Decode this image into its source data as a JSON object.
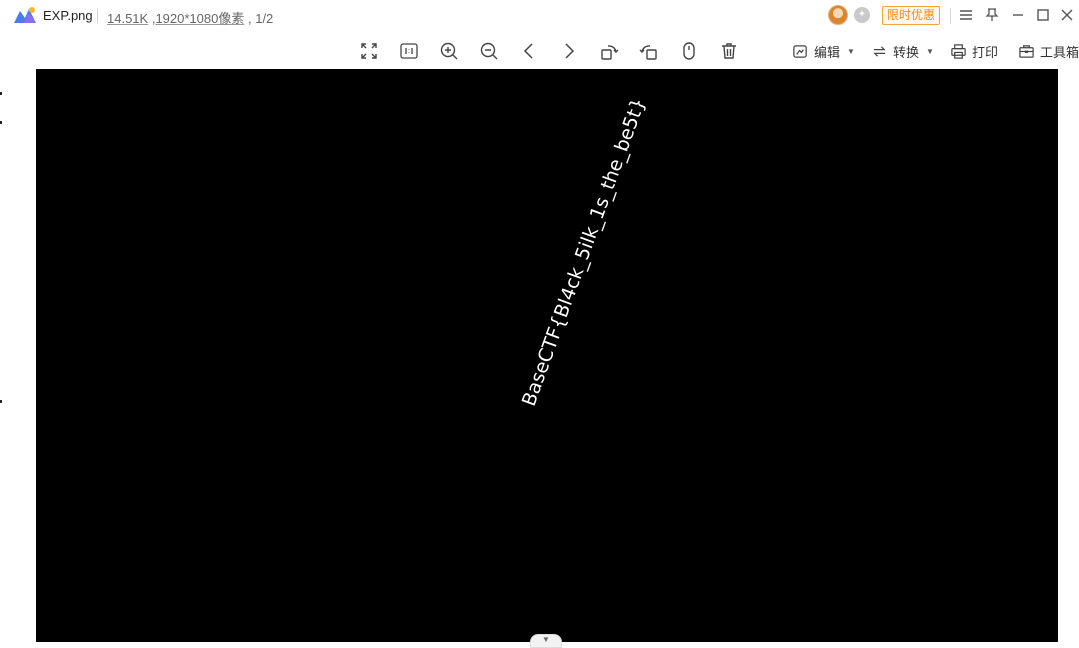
{
  "titlebar": {
    "file_name": "EXP.png",
    "file_size": "14.51K",
    "resolution": "1920*1080像素",
    "page_counter": ", 1/2",
    "promo_label": "限时优惠"
  },
  "toolbar": {
    "edit_label": "编辑",
    "convert_label": "转换",
    "print_label": "打印",
    "toolbox_label": "工具箱"
  },
  "image": {
    "text": "BaseCTF{Bl4ck_5ilk_1s_the_be5t}",
    "background_color": "#000000",
    "text_color": "#ffffff"
  },
  "colors": {
    "promo": "#f08c1a",
    "logo_primary": "#4a7cf0"
  }
}
